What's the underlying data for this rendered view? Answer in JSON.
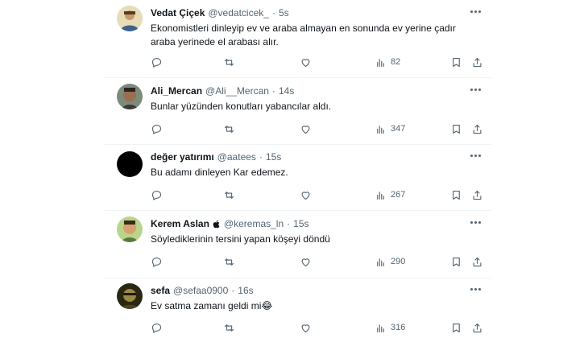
{
  "tweets": [
    {
      "name": "Vedat Çiçek",
      "handle": "@vedatcicek_",
      "separator": "·",
      "time": "5s",
      "text": "Ekonomistleri dinleyip ev ve araba almayan en sonunda ev yerine çadır araba yerinede el arabası alır.",
      "views": "82",
      "avatar_color": "#d9c48a"
    },
    {
      "name": "Ali_Mercan",
      "handle": "@Ali__Mercan",
      "separator": "·",
      "time": "14s",
      "text": "Bunlar yüzünden konutları yabancılar aldı.",
      "views": "347",
      "avatar_color": "#8a6b55"
    },
    {
      "name": "değer yatırımı",
      "handle": "@aatees",
      "separator": "·",
      "time": "15s",
      "text": "Bu adamı dinleyen Kar edemez.",
      "views": "267",
      "avatar_color": "#000000"
    },
    {
      "name": "Kerem Aslan",
      "badge_icon": "apple-icon",
      "handle": "@keremas_ln",
      "separator": "·",
      "time": "15s",
      "text": "Söylediklerinin tersini yapan köşeyi döndü",
      "views": "290",
      "avatar_color": "#a8c97a"
    },
    {
      "name": "sefa",
      "handle": "@sefaa0900",
      "separator": "·",
      "time": "16s",
      "text": "Ev satma zamanı geldi mi😂",
      "views": "316",
      "avatar_color": "#3d3a1f"
    }
  ],
  "icons": {
    "reply": "reply-icon",
    "retweet": "retweet-icon",
    "like": "like-icon",
    "views": "views-icon",
    "bookmark": "bookmark-icon",
    "share": "share-icon",
    "more": "more-icon"
  },
  "colors": {
    "secondary_text": "#536471",
    "primary_text": "#0f1419",
    "divider": "#eff3f4"
  }
}
